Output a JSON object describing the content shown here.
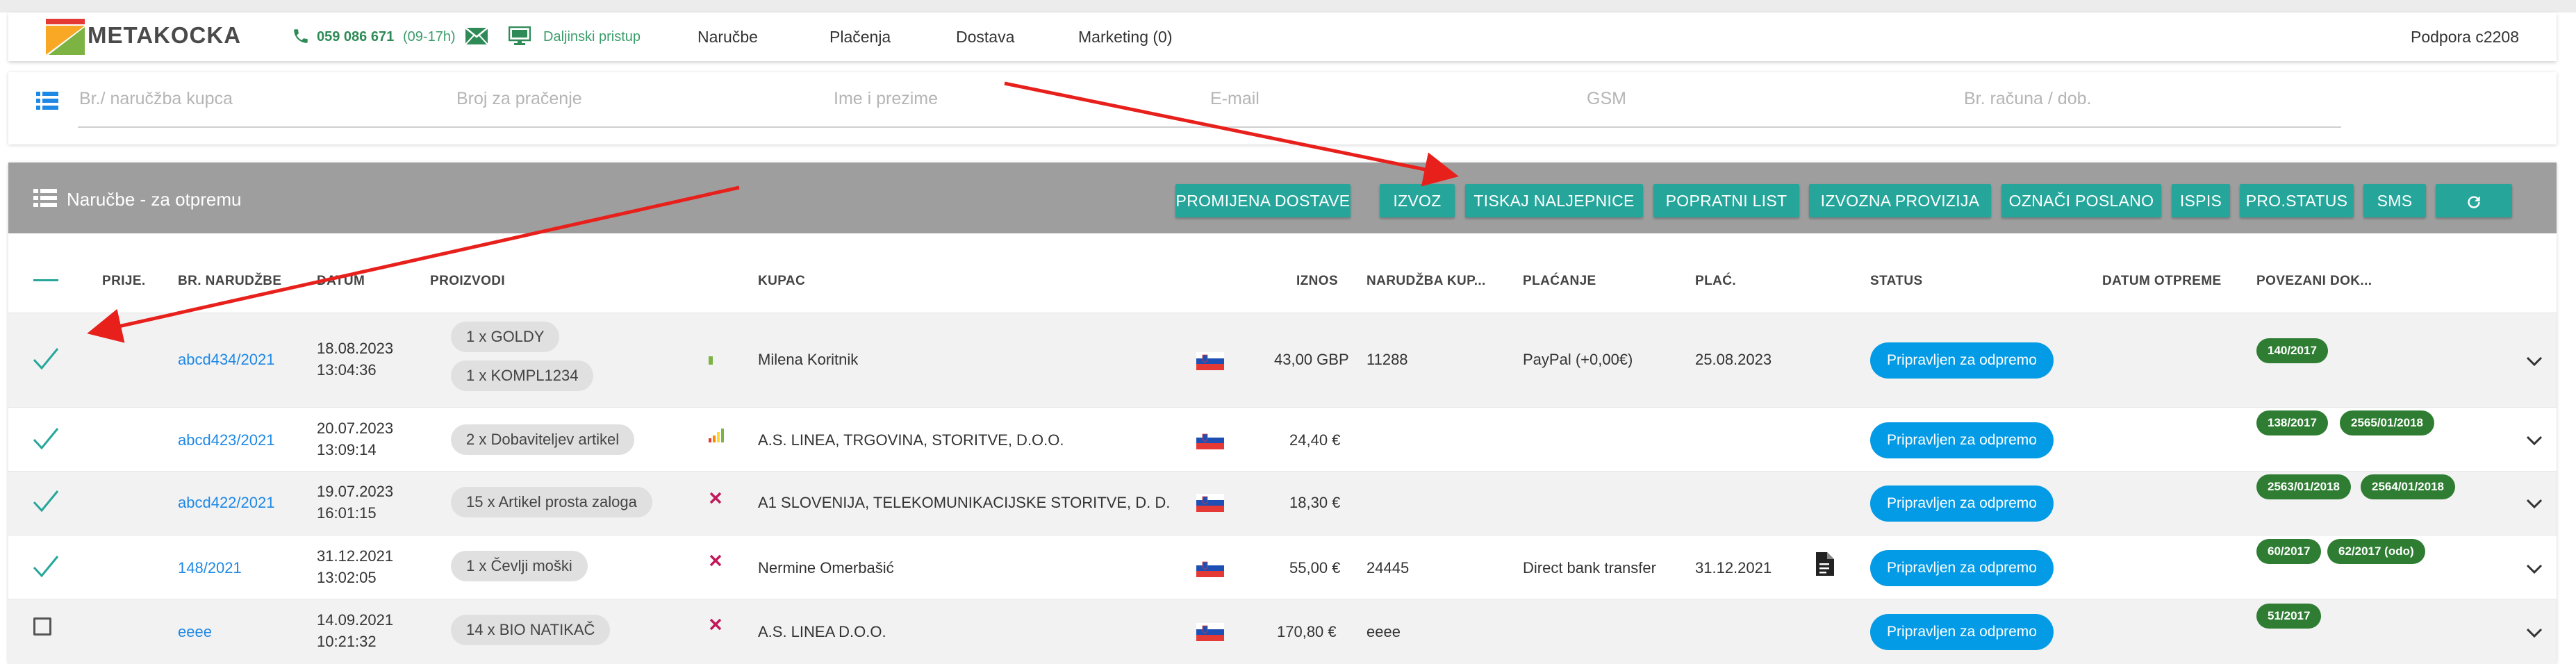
{
  "brand": {
    "name": "METAKOCKA"
  },
  "topbar": {
    "phone": "059 086 671",
    "hours": "(09-17h)",
    "remote": "Daljinski pristup",
    "menu": [
      "Naručbe",
      "Plačenja",
      "Dostava",
      "Marketing (0)"
    ],
    "support": "Podpora c2208"
  },
  "search": {
    "fields": [
      "Br./ naručžba kupca",
      "Broj za pračenje",
      "Ime i prezime",
      "E-mail",
      "GSM",
      "Br. računa / dob."
    ]
  },
  "orders": {
    "title": "Naručbe - za otpremu",
    "buttons": [
      "PROMIJENA DOSTAVE",
      "IZVOZ",
      "TISKAJ NALJEPNICE",
      "POPRATNI LIST",
      "IZVOZNA PROVIZIJA",
      "OZNAČI POSLANO",
      "ISPIS",
      "PRO.STATUS",
      "SMS"
    ],
    "columns": {
      "prije": "PRIJE.",
      "br": "BR. NARUDŽBE",
      "datum": "DATUM",
      "proizvodi": "PROIZVODI",
      "kupac": "KUPAC",
      "iznos": "IZNOS",
      "narudzba_kupca": "NARUDŽBA KUP...",
      "placanje": "PLAĆANJE",
      "plac": "PLAĆ.",
      "status": "STATUS",
      "datum_otpreme": "DATUM OTPREME",
      "povezani": "POVEZANI DOK..."
    },
    "rows": [
      {
        "id": "abcd434/2021",
        "date": "18.08.2023",
        "time": "13:04:36",
        "products": [
          "1 x GOLDY",
          "1 x KOMPL1234"
        ],
        "customer": "Milena Koritnik",
        "amount": "43,00 GBP",
        "customer_order": "11288",
        "payment": "PayPal (+0,00€)",
        "paid_date": "25.08.2023",
        "status": "Pripravljen za odpremo",
        "docs": [
          "140/2017"
        ]
      },
      {
        "id": "abcd423/2021",
        "date": "20.07.2023",
        "time": "13:09:14",
        "products": [
          "2 x Dobaviteljev artikel"
        ],
        "customer": "A.S. LINEA, TRGOVINA, STORITVE, D.O.O.",
        "amount": "24,40 €",
        "customer_order": "",
        "payment": "",
        "paid_date": "",
        "status": "Pripravljen za odpremo",
        "docs": [
          "138/2017",
          "2565/01/2018"
        ]
      },
      {
        "id": "abcd422/2021",
        "date": "19.07.2023",
        "time": "16:01:15",
        "products": [
          "15 x Artikel prosta zaloga"
        ],
        "customer": "A1 SLOVENIJA, TELEKOMUNIKACIJSKE STORITVE, D. D.",
        "amount": "18,30 €",
        "customer_order": "",
        "payment": "",
        "paid_date": "",
        "status": "Pripravljen za odpremo",
        "docs": [
          "2563/01/2018",
          "2564/01/2018"
        ]
      },
      {
        "id": "148/2021",
        "date": "31.12.2021",
        "time": "13:02:05",
        "products": [
          "1 x Čevlji moški"
        ],
        "customer": "Nermine Omerbašić",
        "amount": "55,00 €",
        "customer_order": "24445",
        "payment": "Direct bank transfer",
        "paid_date": "31.12.2021",
        "status": "Pripravljen za odpremo",
        "docs": [
          "60/2017",
          "62/2017 (odo)"
        ]
      },
      {
        "id": "eeee",
        "date": "14.09.2021",
        "time": "10:21:32",
        "products": [
          "14 x BIO NATIKAČ"
        ],
        "customer": "A.S. LINEA D.O.O.",
        "amount": "170,80 €",
        "customer_order": "eeee",
        "payment": "",
        "paid_date": "",
        "status": "Pripravljen za odpremo",
        "docs": [
          "51/2017"
        ]
      }
    ]
  },
  "icons": {
    "phone": "phone-icon",
    "mail": "mail-icon",
    "remote": "monitor-icon",
    "list": "list-icon",
    "check": "check-icon",
    "flag": "slovenia-flag-icon",
    "close": "x-icon",
    "signal": "signal-bars-icon",
    "doc": "document-icon",
    "chevron": "chevron-down-icon",
    "refresh": "refresh-icon"
  },
  "colors": {
    "accent": "#26a69a",
    "status": "#039be5",
    "doc_badge": "#2e7d32",
    "link": "#1e88e5",
    "annotation": "#e8201c"
  }
}
